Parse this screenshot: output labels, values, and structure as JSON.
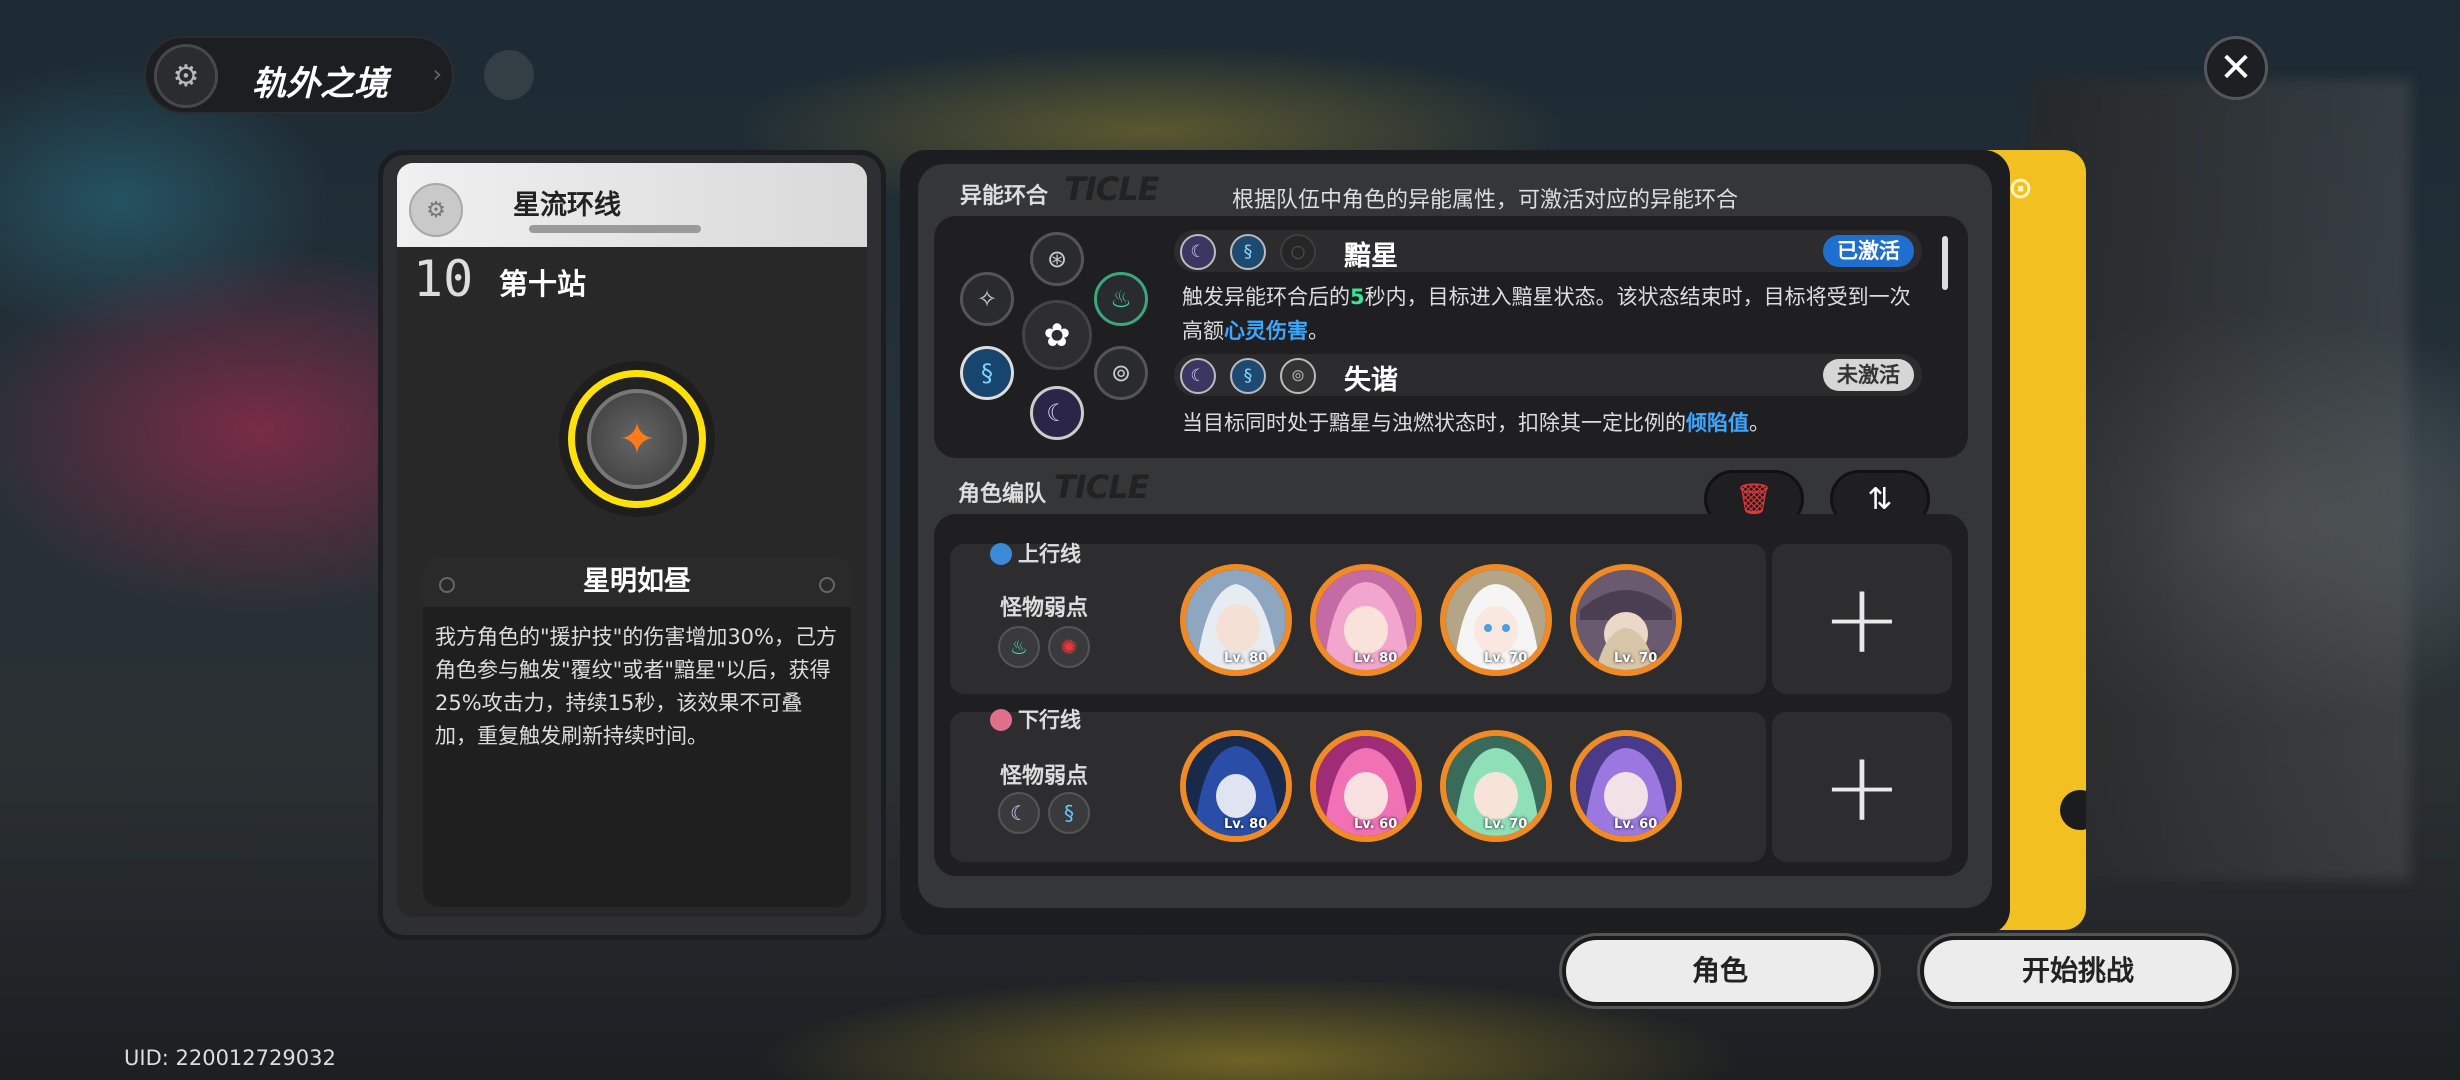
{
  "header": {
    "title": "轨外之境"
  },
  "uid": "UID: 220012729032",
  "left_card": {
    "route_name": "星流环线",
    "station_number": "10",
    "station_name": "第十站",
    "effect_title": "星明如昼",
    "effect_desc": "我方角色的\"援护技\"的伤害增加30%，己方角色参与触发\"覆纹\"或者\"黯星\"以后，获得25%攻击力，持续15秒，该效果不可叠加，重复触发刷新持续时间。"
  },
  "resonance": {
    "section_label": "异能环合",
    "section_deco": "TICLE",
    "section_desc": "根据队伍中角色的异能属性，可激活对应的异能环合",
    "items": [
      {
        "name": "黯星",
        "status": "已激活",
        "active": true,
        "desc_pre": "触发异能环合后的",
        "desc_num": "5",
        "desc_mid": "秒内，目标进入黯星状态。该状态结束时，目标将受到一次高额",
        "desc_hl": "心灵伤害",
        "desc_post": "。"
      },
      {
        "name": "失谐",
        "status": "未激活",
        "active": false,
        "desc_pre": "当目标同时处于黯星与浊燃状态时，扣除其一定比例的",
        "desc_hl": "倾陷值",
        "desc_post": "。"
      }
    ]
  },
  "team": {
    "section_label": "角色编队",
    "section_deco": "TICLE",
    "lanes": [
      {
        "tag": "上行线",
        "weak_label": "怪物弱点",
        "weak_icons": [
          "ether-icon",
          "incantation-icon"
        ],
        "members": [
          {
            "lv": "Lv. 80"
          },
          {
            "lv": "Lv. 80"
          },
          {
            "lv": "Lv. 70"
          },
          {
            "lv": "Lv. 70"
          }
        ]
      },
      {
        "tag": "下行线",
        "weak_label": "怪物弱点",
        "weak_icons": [
          "psyche-icon",
          "cosmos-icon"
        ],
        "members": [
          {
            "lv": "Lv. 80"
          },
          {
            "lv": "Lv. 60"
          },
          {
            "lv": "Lv. 70"
          },
          {
            "lv": "Lv. 60"
          }
        ]
      }
    ]
  },
  "buttons": {
    "characters": "角色",
    "start": "开始挑战"
  },
  "colors": {
    "accent_yellow": "#f2c021",
    "active_blue": "#1f6fd1",
    "highlight_green": "#3ee39a",
    "highlight_blue": "#3ba7ff",
    "avatar_ring": "#f08a24"
  }
}
